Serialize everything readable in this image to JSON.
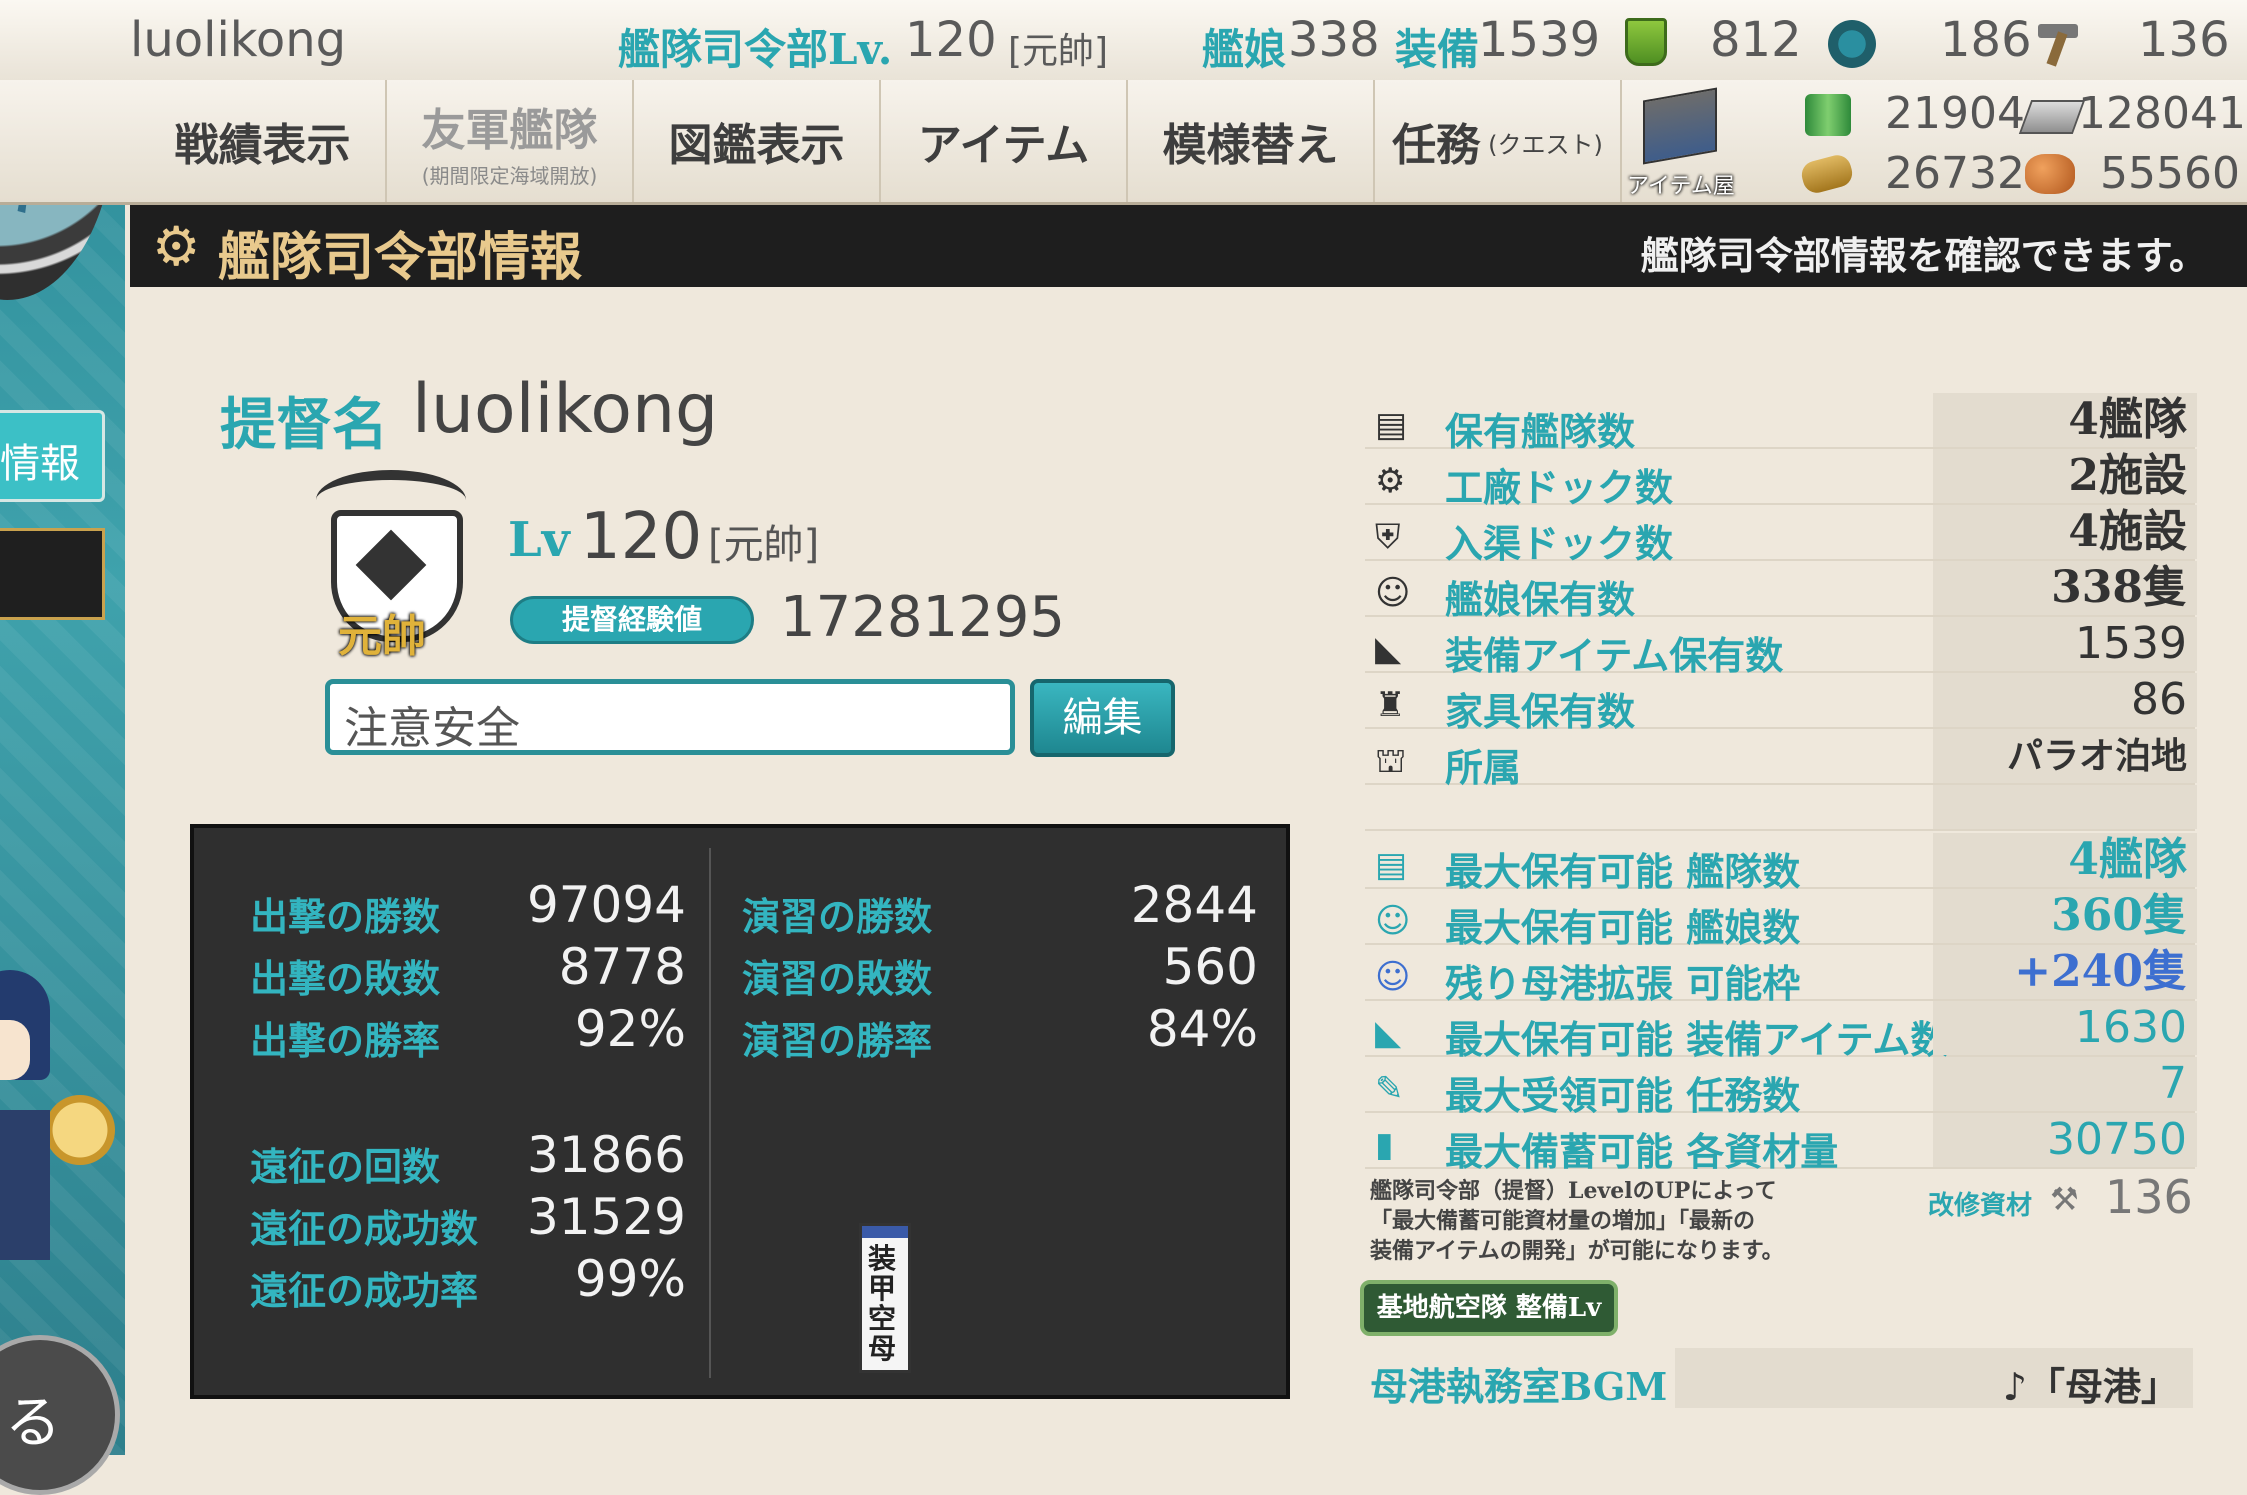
{
  "top": {
    "username": "luolikong",
    "hq_label": "艦隊司令部Lv.",
    "hq_level": "120",
    "rank": "[元帥]",
    "ships_label": "艦娘",
    "ships_count": "338",
    "equip_label": "装備",
    "equip_count": "1539",
    "bucket_count": "812",
    "devmat_count": "186",
    "screw_count": "136"
  },
  "nav": {
    "items": [
      {
        "label": "戦績表示",
        "sub": ""
      },
      {
        "label": "友軍艦隊",
        "sub": "(期間限定海域開放)"
      },
      {
        "label": "図鑑表示",
        "sub": ""
      },
      {
        "label": "アイテム",
        "sub": ""
      },
      {
        "label": "模様替え",
        "sub": ""
      },
      {
        "label": "任務",
        "sub": "(クエスト)"
      }
    ],
    "shop_label": "アイテム屋"
  },
  "resources": {
    "fuel": "21904",
    "steel": "128041",
    "ammo": "26732",
    "bauxite": "55560"
  },
  "header": {
    "title": "艦隊司令部情報",
    "description": "艦隊司令部情報を確認できます。"
  },
  "left_tabs": {
    "info_label": "情報",
    "back_label": "る"
  },
  "profile": {
    "name_label": "提督名",
    "name": "luolikong",
    "lv_label": "Lv",
    "level": "120",
    "rank": "[元帥]",
    "rank_badge_text": "元帥",
    "exp_label": "提督経験値",
    "exp_value": "17281295",
    "comment": "注意安全",
    "edit_label": "編集"
  },
  "stats": {
    "sortie_wins_label": "出撃の勝数",
    "sortie_wins": "97094",
    "sortie_losses_label": "出撃の敗数",
    "sortie_losses": "8778",
    "sortie_rate_label": "出撃の勝率",
    "sortie_rate": "92%",
    "exped_count_label": "遠征の回数",
    "exped_count": "31866",
    "exped_success_label": "遠征の成功数",
    "exped_success": "31529",
    "exped_rate_label": "遠征の成功率",
    "exped_rate": "99%",
    "ex_wins_label": "演習の勝数",
    "ex_wins": "2844",
    "ex_losses_label": "演習の敗数",
    "ex_losses": "560",
    "ex_rate_label": "演習の勝率",
    "ex_rate": "84%",
    "charm_text": "装甲空母"
  },
  "info_table": {
    "rows": [
      {
        "label": "保有艦隊数",
        "value": "4艦隊",
        "icon": "fleet-icon"
      },
      {
        "label": "工廠ドック数",
        "value": "2施設",
        "icon": "gear-icon"
      },
      {
        "label": "入渠ドック数",
        "value": "4施設",
        "icon": "repair-icon"
      },
      {
        "label": "艦娘保有数",
        "value": "338隻",
        "icon": "shipgirl-icon"
      },
      {
        "label": "装備アイテム保有数",
        "value": "1539",
        "icon": "equipment-icon"
      },
      {
        "label": "家具保有数",
        "value": "86",
        "icon": "furniture-icon"
      },
      {
        "label": "所属",
        "value": "パラオ泊地",
        "icon": "base-icon"
      }
    ],
    "max_rows": [
      {
        "label": "最大保有可能 艦隊数",
        "value": "4艦隊",
        "icon": "fleet-icon"
      },
      {
        "label": "最大保有可能 艦娘数",
        "value": "360隻",
        "icon": "shipgirl-icon"
      },
      {
        "label": "残り母港拡張 可能枠",
        "value": "+240隻",
        "icon": "shipgirl-blue-icon"
      },
      {
        "label": "最大保有可能 装備アイテム数",
        "value": "1630",
        "icon": "equipment-icon"
      },
      {
        "label": "最大受領可能 任務数",
        "value": "7",
        "icon": "quill-icon"
      },
      {
        "label": "最大備蓄可能 各資材量",
        "value": "30750",
        "icon": "book-icon"
      }
    ],
    "note_line1": "艦隊司令部（提督）LevelのUPによって",
    "note_line2": "「最大備蓄可能資材量の増加」「最新の",
    "note_line3": "装備アイテムの開発」が可能になります。",
    "improve_label": "改修資材",
    "improve_value": "136",
    "air_base_button": "基地航空隊 整備Lv",
    "bgm_label": "母港執務室BGM",
    "bgm_value": "♪「母港」"
  }
}
